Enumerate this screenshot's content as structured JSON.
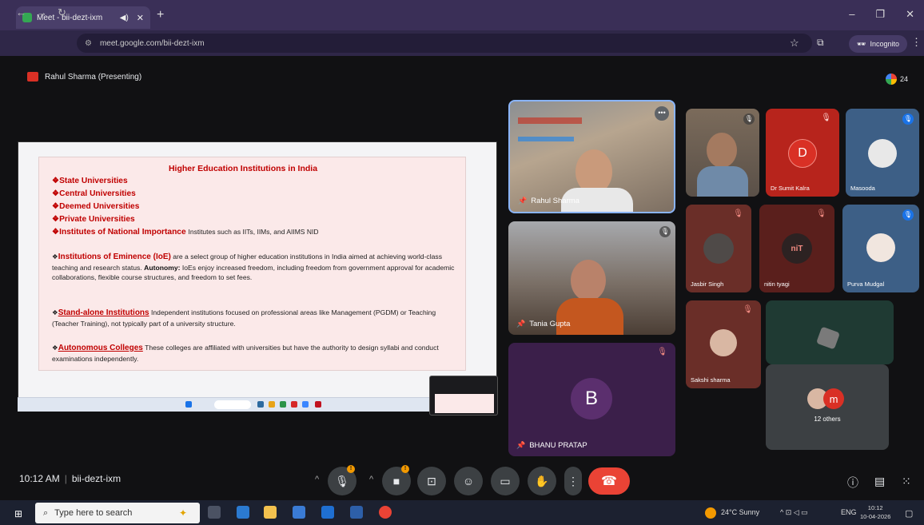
{
  "browser": {
    "tab_title": "Meet - bii-dezt-ixm",
    "url": "meet.google.com/bii-dezt-ixm",
    "incognito_label": "Incognito"
  },
  "meet": {
    "presenting_label": "Rahul Sharma (Presenting)",
    "people_count": "24",
    "time": "10:12 AM",
    "meeting_code": "bii-dezt-ixm"
  },
  "slide": {
    "title": "Higher Education Institutions in India",
    "bullets": [
      "State Universities",
      "Central Universities",
      "Deemed Universities",
      "Private Universities"
    ],
    "ini_heading": "Institutes of National Importance",
    "ini_text": "Institutes such as IITs, IIMs, and AIIMS  NID",
    "ioe_heading": "Institutions of Eminence (IoE)",
    "ioe_text": " are a select group of higher education institutions in India aimed at achieving world-class teaching and research status. ",
    "ioe_autonomy": "Autonomy:",
    "ioe_text2": " IoEs enjoy increased freedom, including freedom from government approval for academic collaborations, flexible course structures, and freedom to set fees.",
    "sai_heading": "Stand-alone Institutions",
    "sai_text": " Independent institutions focused on professional areas like Management (PGDM) or Teaching (Teacher Training), not typically part of a university structure.",
    "ac_heading": "Autonomous Colleges",
    "ac_text": " These colleges are affiliated with universities but have the authority to design syllabi and conduct examinations independently."
  },
  "participants": {
    "rahul": "Rahul Sharma",
    "tania": "Tania Gupta",
    "bhanu": "BHANU PRATAP",
    "bhanu_initial": "B",
    "sumit": "Dr Sumit Kalra",
    "sumit_initial": "D",
    "masooda": "Masooda",
    "jasbir": "Jasbir Singh",
    "nitin": "nitin tyagi",
    "purva": "Purva Mudgal",
    "sakshi": "Sakshi sharma",
    "others": "12 others",
    "others_initial": "m"
  },
  "taskbar": {
    "search_placeholder": "Type here to search",
    "weather": "24°C  Sunny",
    "lang": "ENG",
    "clock_time": "10:12",
    "clock_date": "10-04-2026"
  },
  "colors": {
    "accent_red": "#c00000",
    "end_call": "#ea4335",
    "bhanu_tile": "#3b1f4a"
  }
}
